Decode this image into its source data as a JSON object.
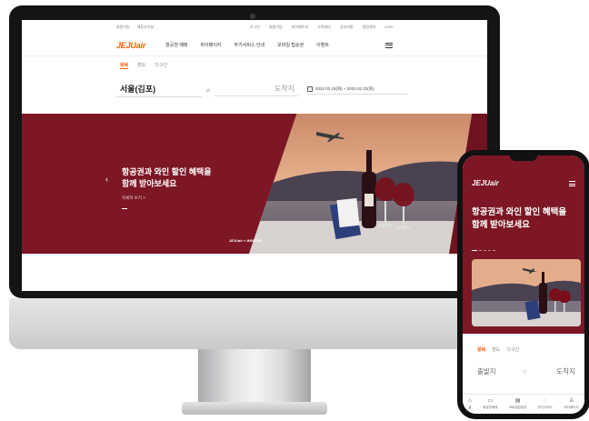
{
  "desktop": {
    "utility_links": {
      "left": [
        "회원가입",
        "제휴오브샵"
      ],
      "right": [
        "로그인",
        "회원가입",
        "마이페이지",
        "고객센터",
        "공지사항",
        "알림센터",
        "KOR"
      ]
    },
    "logo": "JEJUair",
    "nav": [
      "항공권 예매",
      "마이페이지",
      "부가서비스 안내",
      "모바일 탑승권",
      "이벤트"
    ],
    "booking": {
      "tabs": [
        "왕복",
        "편도",
        "다구간"
      ],
      "from": "서울(김포)",
      "to": "도착지",
      "dates": "2022.02.15(화) ~ 2022.02.22(화)"
    },
    "hero": {
      "title_line1": "항공권과 와인 할인 혜택을",
      "title_line2": "함께 받아보세요",
      "more": "자세히 보기 >",
      "prev_icon": "chevron-left-icon",
      "brand": "JEJUair × WINE25+"
    }
  },
  "mobile": {
    "logo": "JEJUair",
    "hero": {
      "title_line1": "항공권과 와인 할인 혜택을",
      "title_line2": "함께 받아보세요"
    },
    "booking": {
      "tabs": [
        "왕복",
        "편도",
        "다구간"
      ],
      "from": "출발지",
      "to": "도착지"
    },
    "tabbar": [
      {
        "label": "홈",
        "icon": "home-icon"
      },
      {
        "label": "항공권예매",
        "icon": "ticket-icon"
      },
      {
        "label": "모바일탑승권",
        "icon": "boarding-pass-icon"
      },
      {
        "label": "부가서비스",
        "icon": "service-icon"
      },
      {
        "label": "마이페이지",
        "icon": "user-icon"
      }
    ]
  },
  "colors": {
    "brand_orange": "#ff5a00",
    "hero_burgundy": "#7d1725"
  }
}
